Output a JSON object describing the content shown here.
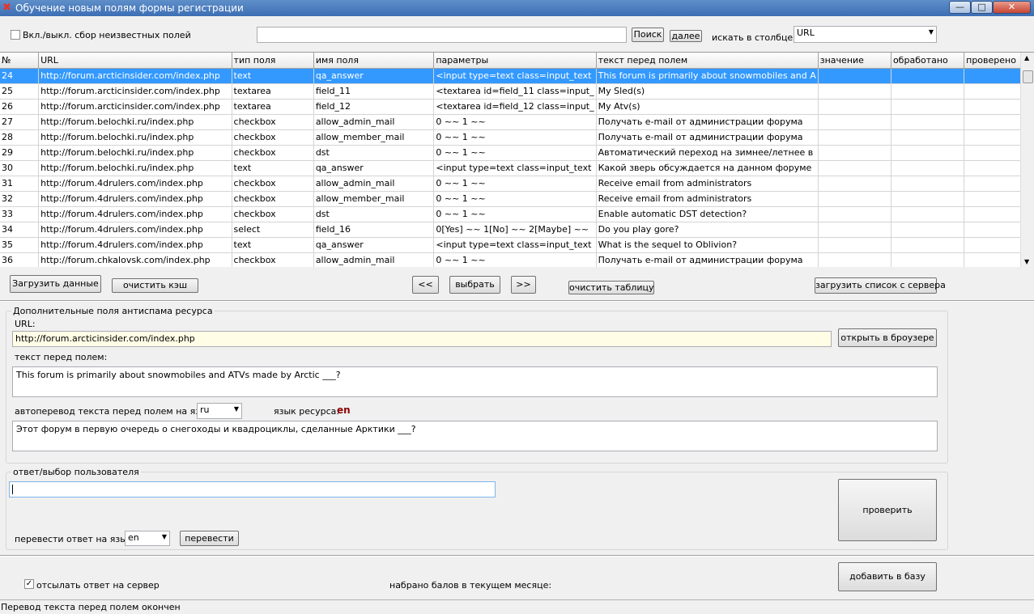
{
  "window": {
    "title": "Обучение новым полям формы регистрации",
    "minimize": "—",
    "maximize": "□",
    "close": "✕"
  },
  "toolbar": {
    "toggle_label": "Вкл./выкл. сбор неизвестных полей",
    "toggle_checked": false,
    "search_value": "",
    "search_button": "Поиск",
    "next_button": "далее",
    "column_label": "искать в столбце:",
    "column_select": "URL"
  },
  "table": {
    "columns": [
      "№",
      "URL",
      "тип поля",
      "имя поля",
      "параметры",
      "текст перед полем",
      "значение",
      "обработано",
      "проверено"
    ],
    "rows": [
      [
        "24",
        "http://forum.arcticinsider.com/index.php",
        "text",
        "qa_answer",
        "<input type=text class=input_text",
        "This forum is primarily about snowmobiles and A",
        "",
        "",
        ""
      ],
      [
        "25",
        "http://forum.arcticinsider.com/index.php",
        "textarea",
        "field_11",
        "<textarea id=field_11 class=input_",
        "My Sled(s)",
        "",
        "",
        ""
      ],
      [
        "26",
        "http://forum.arcticinsider.com/index.php",
        "textarea",
        "field_12",
        "<textarea id=field_12 class=input_",
        "My Atv(s)",
        "",
        "",
        ""
      ],
      [
        "27",
        "http://forum.belochki.ru/index.php",
        "checkbox",
        "allow_admin_mail",
        "0 ~~ 1 ~~",
        "Получать e-mail от администрации форума",
        "",
        "",
        ""
      ],
      [
        "28",
        "http://forum.belochki.ru/index.php",
        "checkbox",
        "allow_member_mail",
        "0 ~~ 1 ~~",
        "Получать e-mail от администрации форума",
        "",
        "",
        ""
      ],
      [
        "29",
        "http://forum.belochki.ru/index.php",
        "checkbox",
        "dst",
        "0 ~~ 1 ~~",
        "Автоматический переход на зимнее/летнее в",
        "",
        "",
        ""
      ],
      [
        "30",
        "http://forum.belochki.ru/index.php",
        "text",
        "qa_answer",
        "<input type=text class=input_text",
        "Какой зверь обсуждается на данном форуме",
        "",
        "",
        ""
      ],
      [
        "31",
        "http://forum.4drulers.com/index.php",
        "checkbox",
        "allow_admin_mail",
        "0 ~~ 1 ~~",
        "Receive email from administrators",
        "",
        "",
        ""
      ],
      [
        "32",
        "http://forum.4drulers.com/index.php",
        "checkbox",
        "allow_member_mail",
        "0 ~~ 1 ~~",
        "Receive email from administrators",
        "",
        "",
        ""
      ],
      [
        "33",
        "http://forum.4drulers.com/index.php",
        "checkbox",
        "dst",
        "0 ~~ 1 ~~",
        "Enable automatic DST detection?",
        "",
        "",
        ""
      ],
      [
        "34",
        "http://forum.4drulers.com/index.php",
        "select",
        "field_16",
        "0[Yes] ~~ 1[No] ~~ 2[Maybe] ~~",
        "Do you play gore?",
        "",
        "",
        ""
      ],
      [
        "35",
        "http://forum.4drulers.com/index.php",
        "text",
        "qa_answer",
        "<input type=text class=input_text",
        "What is the sequel to Oblivion?",
        "",
        "",
        ""
      ],
      [
        "36",
        "http://forum.chkalovsk.com/index.php",
        "checkbox",
        "allow_admin_mail",
        "0 ~~ 1 ~~",
        "Получать e-mail от администрации форума",
        "",
        "",
        ""
      ]
    ]
  },
  "actions": {
    "load_data": "Загрузить данные",
    "clear_cache": "очистить кэш",
    "prev": "<<",
    "select": "выбрать",
    "next": ">>",
    "clear_table": "очистить таблицу",
    "load_from_server": "загрузить список с сервера"
  },
  "details": {
    "group_title": "Дополнительные поля антиспама ресурса",
    "url_label": "URL:",
    "url_value": "http://forum.arcticinsider.com/index.php",
    "open_browser": "открыть в броузере",
    "text_before_label": "текст перед полем:",
    "text_before_value": "This forum is primarily about snowmobiles and ATVs made by Arctic ___?",
    "autotranslate_label": "автоперевод текста перед полем на язык:",
    "autotranslate_lang": "ru",
    "resource_lang_label": "язык ресурса:",
    "resource_lang_value": "en",
    "translated_value": "Этот форум в первую очередь о снегоходы и квадроциклы, сделанные Арктики ___?"
  },
  "answer": {
    "group_title": "ответ/выбор пользователя",
    "answer_value": "",
    "translate_label": "перевести ответ на язык",
    "translate_lang": "en",
    "translate_button": "перевести",
    "check_button": "проверить"
  },
  "footer": {
    "send_label": "отсылать ответ на сервер",
    "send_checked": true,
    "score_label": "набрано балов в текущем месяце:",
    "add_button": "добавить в базу",
    "status": "Перевод текста перед полем окончен"
  },
  "colors": {
    "selection": "#3399ff",
    "url_field": "#fffde6",
    "lang_accent": "#8b0000"
  }
}
